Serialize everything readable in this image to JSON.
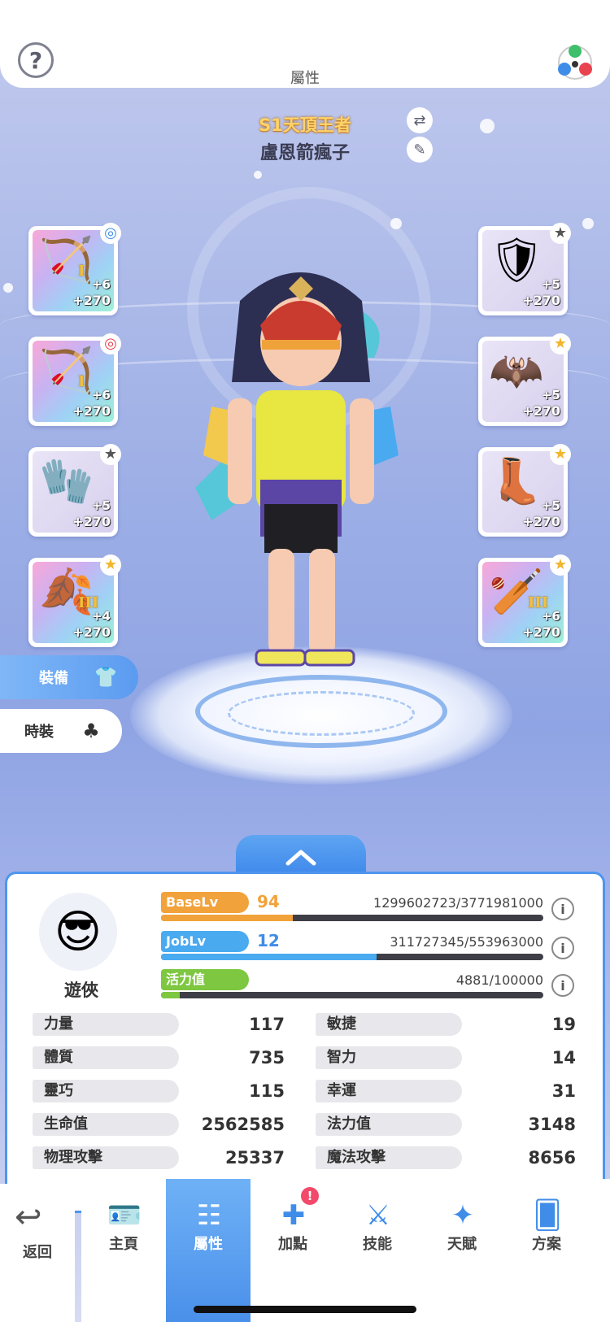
{
  "header": {
    "title": "屬性",
    "help_label": "?"
  },
  "profile": {
    "title_badge": "S1天頂王者",
    "name": "盧恩箭瘋子"
  },
  "equipment_left": [
    {
      "rank": "I",
      "plus": "+6",
      "refine": "+270",
      "icon": "bow-icon"
    },
    {
      "rank": "I",
      "plus": "+6",
      "refine": "+270",
      "icon": "bow-icon"
    },
    {
      "rank": "",
      "plus": "+5",
      "refine": "+270",
      "icon": "gauntlet-icon"
    },
    {
      "rank": "III",
      "plus": "+4",
      "refine": "+270",
      "icon": "cape-icon"
    }
  ],
  "equipment_right": [
    {
      "rank": "",
      "plus": "+5",
      "refine": "+270",
      "icon": "armor-icon"
    },
    {
      "rank": "",
      "plus": "+5",
      "refine": "+270",
      "icon": "cloak-icon"
    },
    {
      "rank": "",
      "plus": "+5",
      "refine": "+270",
      "icon": "boots-icon"
    },
    {
      "rank": "III",
      "plus": "+6",
      "refine": "+270",
      "icon": "club-icon"
    }
  ],
  "side_tabs": {
    "equipment": "裝備",
    "costume": "時裝"
  },
  "character": {
    "job": "遊俠",
    "base": {
      "tag": "BaseLv",
      "level": "94",
      "exp": "1299602723/3771981000",
      "progress": 0.345,
      "color": "#f2a23a"
    },
    "jobl": {
      "tag": "JobLv",
      "level": "12",
      "exp": "311727345/553963000",
      "progress": 0.563,
      "color": "#4aaaf0"
    },
    "vit": {
      "tag": "活力值",
      "exp": "4881/100000",
      "progress": 0.049,
      "color": "#7ec741"
    }
  },
  "stats": [
    {
      "label": "力量",
      "value": "117"
    },
    {
      "label": "敏捷",
      "value": "19"
    },
    {
      "label": "體質",
      "value": "735"
    },
    {
      "label": "智力",
      "value": "14"
    },
    {
      "label": "靈巧",
      "value": "115"
    },
    {
      "label": "幸運",
      "value": "31"
    },
    {
      "label": "生命值",
      "value": "2562585"
    },
    {
      "label": "法力值",
      "value": "3148"
    },
    {
      "label": "物理攻擊",
      "value": "25337"
    },
    {
      "label": "魔法攻擊",
      "value": "8656"
    }
  ],
  "nav": {
    "back": "返回",
    "items": [
      {
        "label": "主頁",
        "icon": "id-card-icon"
      },
      {
        "label": "屬性",
        "icon": "attributes-icon"
      },
      {
        "label": "加點",
        "icon": "add-point-icon",
        "badge": "!"
      },
      {
        "label": "技能",
        "icon": "skill-icon"
      },
      {
        "label": "天賦",
        "icon": "talent-icon"
      },
      {
        "label": "方案",
        "icon": "cards-icon"
      }
    ]
  }
}
